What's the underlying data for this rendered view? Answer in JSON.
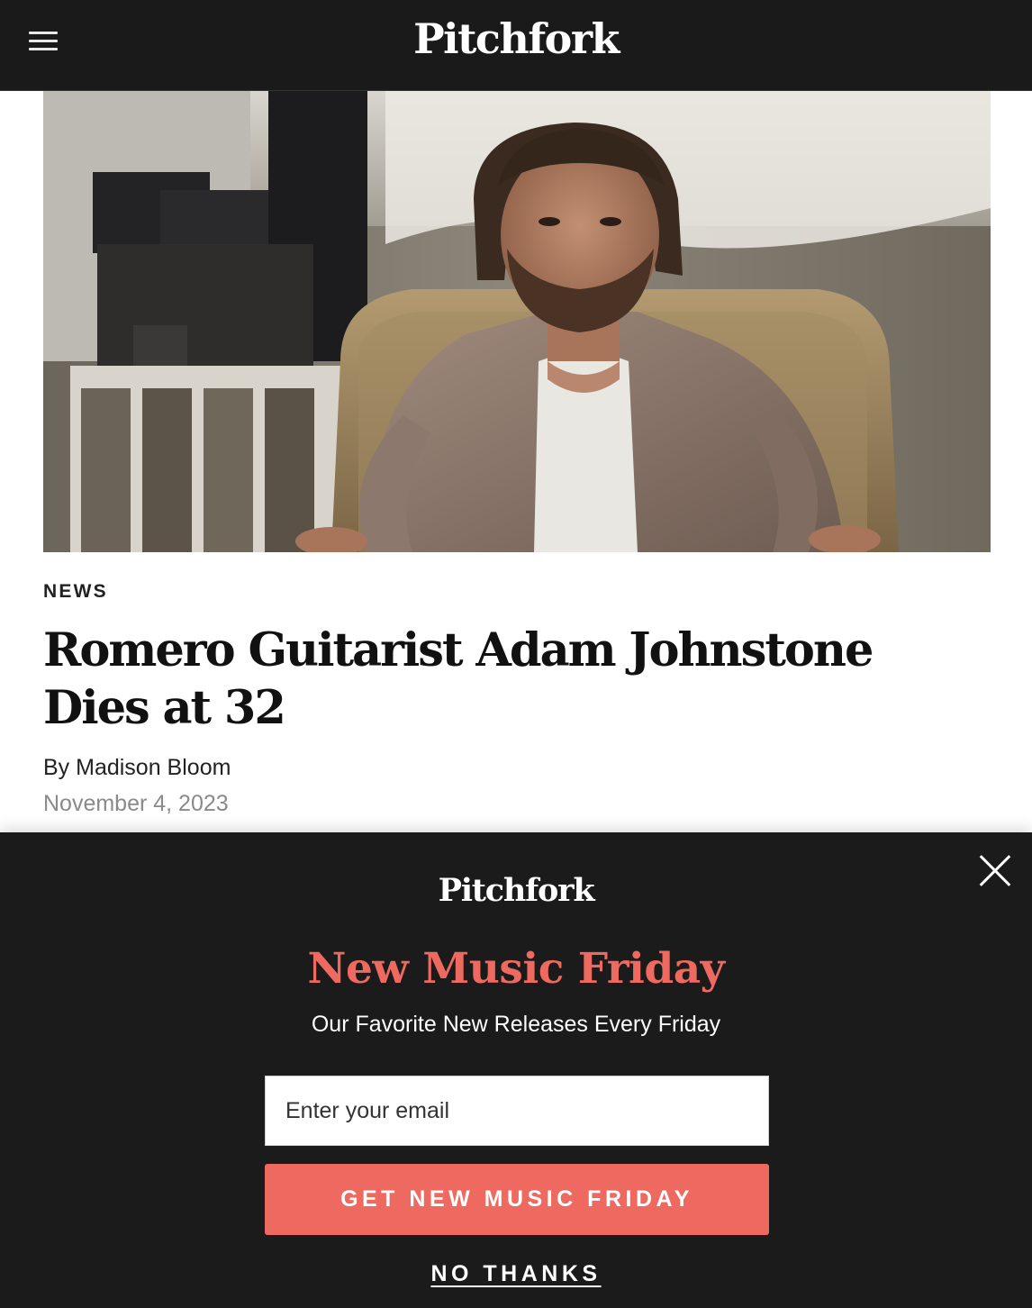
{
  "header": {
    "logo": "Pitchfork",
    "menu_icon": "hamburger-menu-icon"
  },
  "hero": {
    "image_subject": "portrait photo"
  },
  "article": {
    "rubric": "NEWS",
    "headline": "Romero Guitarist Adam Johnstone Dies at 32",
    "byline": "By Madison Bloom",
    "date": "November 4, 2023"
  },
  "newsletter": {
    "logo": "Pitchfork",
    "title": "New Music Friday",
    "subtitle": "Our Favorite New Releases Every Friday",
    "email_placeholder": "Enter your email",
    "email_value": "",
    "cta_label": "GET NEW MUSIC FRIDAY",
    "decline_label": "NO THANKS",
    "close_icon": "close-icon"
  },
  "colors": {
    "header_bg": "#1a1a1a",
    "modal_bg": "#1b1b1b",
    "accent": "#ee6a60",
    "text_dark": "#111111",
    "date_gray": "#8a8a8a"
  }
}
